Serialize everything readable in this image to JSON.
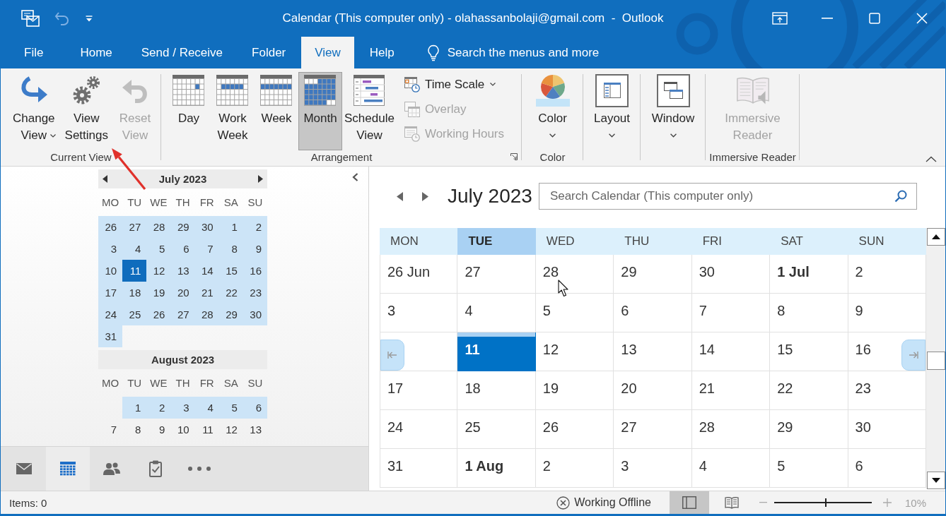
{
  "window": {
    "title": "Calendar (This computer only) - olahassanbolaji@gmail.com  -  Outlook"
  },
  "quick_access": {
    "undo": {
      "disabled": true
    }
  },
  "tabs": [
    {
      "label": "File",
      "selected": false
    },
    {
      "label": "Home",
      "selected": false
    },
    {
      "label": "Send / Receive",
      "selected": false
    },
    {
      "label": "Folder",
      "selected": false
    },
    {
      "label": "View",
      "selected": true
    },
    {
      "label": "Help",
      "selected": false
    }
  ],
  "tell_me": {
    "placeholder": "Search the menus and more"
  },
  "ribbon": {
    "groups": [
      {
        "label": "Current View",
        "buttons": [
          {
            "label": "Change View",
            "disabled": false,
            "dropdown": true
          },
          {
            "label": "View Settings",
            "disabled": false,
            "dropdown": false
          },
          {
            "label": "Reset View",
            "disabled": true,
            "dropdown": false
          }
        ]
      },
      {
        "label": "Arrangement",
        "launcher": true,
        "buttons": [
          {
            "kind": "large",
            "label": "Day",
            "selected": false,
            "disabled": false,
            "dropdown": false
          },
          {
            "kind": "large",
            "label": "Work Week",
            "selected": false,
            "disabled": false,
            "dropdown": false
          },
          {
            "kind": "large",
            "label": "Week",
            "selected": false,
            "disabled": false,
            "dropdown": false
          },
          {
            "kind": "large",
            "label": "Month",
            "selected": true,
            "disabled": false,
            "dropdown": false
          },
          {
            "kind": "large",
            "label": "Schedule View",
            "selected": false,
            "disabled": false,
            "dropdown": false
          },
          {
            "kind": "small",
            "label": "Time Scale",
            "selected": false,
            "disabled": false,
            "dropdown": true
          },
          {
            "kind": "small",
            "label": "Overlay",
            "selected": false,
            "disabled": true,
            "dropdown": false
          },
          {
            "kind": "small",
            "label": "Working Hours",
            "selected": false,
            "disabled": true,
            "dropdown": false
          }
        ]
      },
      {
        "label": "Color",
        "buttons": [
          {
            "label": "Color",
            "disabled": false,
            "dropdown": true
          }
        ]
      },
      {
        "buttons": [
          {
            "label": "Layout",
            "disabled": false,
            "dropdown": true
          }
        ]
      },
      {
        "buttons": [
          {
            "label": "Window",
            "disabled": false,
            "dropdown": true
          }
        ]
      },
      {
        "label": "Immersive Reader",
        "buttons": [
          {
            "label": "Immersive Reader",
            "disabled": true,
            "dropdown": false
          }
        ]
      }
    ]
  },
  "navigation_pane": {
    "mini_calendars": [
      {
        "title": "July 2023",
        "arrows": true,
        "weekdays": [
          "MO",
          "TU",
          "WE",
          "TH",
          "FR",
          "SA",
          "SU"
        ],
        "weeks": [
          {
            "days": [
              {
                "day": "26",
                "highlighted": true,
                "selected": false
              },
              {
                "day": "27",
                "highlighted": true,
                "selected": false
              },
              {
                "day": "28",
                "highlighted": true,
                "selected": false
              },
              {
                "day": "29",
                "highlighted": true,
                "selected": false
              },
              {
                "day": "30",
                "highlighted": true,
                "selected": false
              },
              {
                "day": "1",
                "highlighted": true,
                "selected": false
              },
              {
                "day": "2",
                "highlighted": true,
                "selected": false
              }
            ]
          },
          {
            "days": [
              {
                "day": "3",
                "highlighted": true,
                "selected": false
              },
              {
                "day": "4",
                "highlighted": true,
                "selected": false
              },
              {
                "day": "5",
                "highlighted": true,
                "selected": false
              },
              {
                "day": "6",
                "highlighted": true,
                "selected": false
              },
              {
                "day": "7",
                "highlighted": true,
                "selected": false
              },
              {
                "day": "8",
                "highlighted": true,
                "selected": false
              },
              {
                "day": "9",
                "highlighted": true,
                "selected": false
              }
            ]
          },
          {
            "days": [
              {
                "day": "10",
                "highlighted": true,
                "selected": false
              },
              {
                "day": "11",
                "highlighted": true,
                "selected": true
              },
              {
                "day": "12",
                "highlighted": true,
                "selected": false
              },
              {
                "day": "13",
                "highlighted": true,
                "selected": false
              },
              {
                "day": "14",
                "highlighted": true,
                "selected": false
              },
              {
                "day": "15",
                "highlighted": true,
                "selected": false
              },
              {
                "day": "16",
                "highlighted": true,
                "selected": false
              }
            ]
          },
          {
            "days": [
              {
                "day": "17",
                "highlighted": true,
                "selected": false
              },
              {
                "day": "18",
                "highlighted": true,
                "selected": false
              },
              {
                "day": "19",
                "highlighted": true,
                "selected": false
              },
              {
                "day": "20",
                "highlighted": true,
                "selected": false
              },
              {
                "day": "21",
                "highlighted": true,
                "selected": false
              },
              {
                "day": "22",
                "highlighted": true,
                "selected": false
              },
              {
                "day": "23",
                "highlighted": true,
                "selected": false
              }
            ]
          },
          {
            "days": [
              {
                "day": "24",
                "highlighted": true,
                "selected": false
              },
              {
                "day": "25",
                "highlighted": true,
                "selected": false
              },
              {
                "day": "26",
                "highlighted": true,
                "selected": false
              },
              {
                "day": "27",
                "highlighted": true,
                "selected": false
              },
              {
                "day": "28",
                "highlighted": true,
                "selected": false
              },
              {
                "day": "29",
                "highlighted": true,
                "selected": false
              },
              {
                "day": "30",
                "highlighted": true,
                "selected": false
              }
            ]
          },
          {
            "align_end": false,
            "days": [
              {
                "day": "31",
                "highlighted": true,
                "selected": false
              }
            ]
          }
        ]
      },
      {
        "title": "August 2023",
        "arrows": false,
        "weekdays": [
          "MO",
          "TU",
          "WE",
          "TH",
          "FR",
          "SA",
          "SU"
        ],
        "weeks": [
          {
            "align_end": true,
            "days": [
              {
                "day": "1",
                "highlighted": true,
                "selected": false
              },
              {
                "day": "2",
                "highlighted": true,
                "selected": false
              },
              {
                "day": "3",
                "highlighted": true,
                "selected": false
              },
              {
                "day": "4",
                "highlighted": true,
                "selected": false
              },
              {
                "day": "5",
                "highlighted": true,
                "selected": false
              },
              {
                "day": "6",
                "highlighted": true,
                "selected": false
              }
            ]
          },
          {
            "days": [
              {
                "day": "7",
                "highlighted": false,
                "selected": false
              },
              {
                "day": "8",
                "highlighted": false,
                "selected": false
              },
              {
                "day": "9",
                "highlighted": false,
                "selected": false
              },
              {
                "day": "10",
                "highlighted": false,
                "selected": false
              },
              {
                "day": "11",
                "highlighted": false,
                "selected": false
              },
              {
                "day": "12",
                "highlighted": false,
                "selected": false
              },
              {
                "day": "13",
                "highlighted": false,
                "selected": false
              }
            ]
          }
        ]
      }
    ],
    "modules": [
      {
        "selected": false
      },
      {
        "selected": true
      },
      {
        "selected": false
      },
      {
        "selected": false
      },
      {
        "selected": false
      }
    ]
  },
  "calendar": {
    "title": "July 2023",
    "search": {
      "placeholder": "Search Calendar (This computer only)"
    },
    "weekdays": [
      {
        "label": "MON",
        "today": false
      },
      {
        "label": "TUE",
        "today": true
      },
      {
        "label": "WED",
        "today": false
      },
      {
        "label": "THU",
        "today": false
      },
      {
        "label": "FRI",
        "today": false
      },
      {
        "label": "SAT",
        "today": false
      },
      {
        "label": "SUN",
        "today": false
      }
    ],
    "weeks": [
      [
        {
          "day": "26 Jun",
          "bold": false,
          "selected": false,
          "today": false
        },
        {
          "day": "27",
          "bold": false,
          "selected": false,
          "today": false
        },
        {
          "day": "28",
          "bold": false,
          "selected": false,
          "today": false
        },
        {
          "day": "29",
          "bold": false,
          "selected": false,
          "today": false
        },
        {
          "day": "30",
          "bold": false,
          "selected": false,
          "today": false
        },
        {
          "day": "1 Jul",
          "bold": true,
          "selected": false,
          "today": false
        },
        {
          "day": "2",
          "bold": false,
          "selected": false,
          "today": false
        }
      ],
      [
        {
          "day": "3",
          "bold": false,
          "selected": false,
          "today": false
        },
        {
          "day": "4",
          "bold": false,
          "selected": false,
          "today": false
        },
        {
          "day": "5",
          "bold": false,
          "selected": false,
          "today": false
        },
        {
          "day": "6",
          "bold": false,
          "selected": false,
          "today": false
        },
        {
          "day": "7",
          "bold": false,
          "selected": false,
          "today": false
        },
        {
          "day": "8",
          "bold": false,
          "selected": false,
          "today": false
        },
        {
          "day": "9",
          "bold": false,
          "selected": false,
          "today": false
        }
      ],
      [
        {
          "selected": false,
          "today": false
        },
        {
          "day": "11",
          "bold": true,
          "selected": true,
          "today": true
        },
        {
          "day": "12",
          "bold": false,
          "selected": false,
          "today": false
        },
        {
          "day": "13",
          "bold": false,
          "selected": false,
          "today": false
        },
        {
          "day": "14",
          "bold": false,
          "selected": false,
          "today": false
        },
        {
          "day": "15",
          "bold": false,
          "selected": false,
          "today": false
        },
        {
          "day": "16",
          "bold": false,
          "selected": false,
          "today": false
        }
      ],
      [
        {
          "day": "17",
          "bold": false,
          "selected": false,
          "today": false
        },
        {
          "day": "18",
          "bold": false,
          "selected": false,
          "today": false
        },
        {
          "day": "19",
          "bold": false,
          "selected": false,
          "today": false
        },
        {
          "day": "20",
          "bold": false,
          "selected": false,
          "today": false
        },
        {
          "day": "21",
          "bold": false,
          "selected": false,
          "today": false
        },
        {
          "day": "22",
          "bold": false,
          "selected": false,
          "today": false
        },
        {
          "day": "23",
          "bold": false,
          "selected": false,
          "today": false
        }
      ],
      [
        {
          "day": "24",
          "bold": false,
          "selected": false,
          "today": false
        },
        {
          "day": "25",
          "bold": false,
          "selected": false,
          "today": false
        },
        {
          "day": "26",
          "bold": false,
          "selected": false,
          "today": false
        },
        {
          "day": "27",
          "bold": false,
          "selected": false,
          "today": false
        },
        {
          "day": "28",
          "bold": false,
          "selected": false,
          "today": false
        },
        {
          "day": "29",
          "bold": false,
          "selected": false,
          "today": false
        },
        {
          "day": "30",
          "bold": false,
          "selected": false,
          "today": false
        }
      ],
      [
        {
          "day": "31",
          "bold": false,
          "selected": false,
          "today": false
        },
        {
          "day": "1 Aug",
          "bold": true,
          "selected": false,
          "today": false
        },
        {
          "day": "2",
          "bold": false,
          "selected": false,
          "today": false
        },
        {
          "day": "3",
          "bold": false,
          "selected": false,
          "today": false
        },
        {
          "day": "4",
          "bold": false,
          "selected": false,
          "today": false
        },
        {
          "day": "5",
          "bold": false,
          "selected": false,
          "today": false
        },
        {
          "day": "6",
          "bold": false,
          "selected": false,
          "today": false
        }
      ]
    ]
  },
  "status_bar": {
    "items": "Items: 0",
    "connection": "Working Offline",
    "views": [
      {
        "selected": true
      },
      {
        "selected": false
      }
    ],
    "zoom": {
      "level": 0.53,
      "reading": "10%"
    }
  }
}
